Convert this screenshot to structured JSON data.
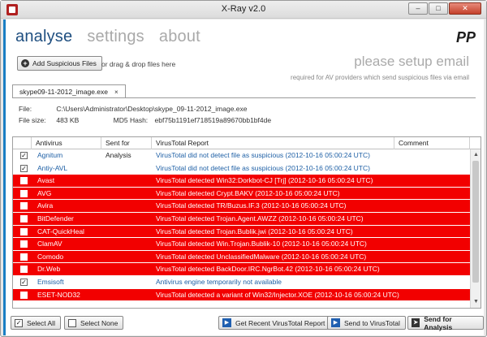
{
  "window": {
    "title": "X-Ray v2.0"
  },
  "nav": {
    "tabs": [
      {
        "label": "analyse"
      },
      {
        "label": "settings"
      },
      {
        "label": "about"
      }
    ]
  },
  "logo_text": "PP",
  "toolbar": {
    "add_label": "Add Suspicious Files",
    "drag_text": "or drag & drop files here"
  },
  "email_notice": {
    "title": "please setup email",
    "subtitle": "required for AV providers which send suspicious files via email"
  },
  "file_tab": {
    "label": "skype09-11-2012_image.exe",
    "close": "×"
  },
  "file_info": {
    "file_label": "File:",
    "file_path": "C:\\Users\\Administrator\\Desktop\\skype_09-11-2012_image.exe",
    "size_label": "File size:",
    "size_value": "483 KB",
    "md5_label": "MD5 Hash:",
    "md5_value": "ebf75b1191ef718519a89670bb1bf4de"
  },
  "grid": {
    "columns": [
      "Antivirus",
      "Sent for Analysis",
      "VirusTotal Report",
      "Comment"
    ],
    "rows": [
      {
        "checked": true,
        "detected": false,
        "antivirus": "Agnitum",
        "report": "VirusTotal did not detect file as suspicious (2012-10-16 05:00:24 UTC)"
      },
      {
        "checked": true,
        "detected": false,
        "antivirus": "Antiy-AVL",
        "report": "VirusTotal did not detect file as suspicious (2012-10-16 05:00:24 UTC)"
      },
      {
        "checked": false,
        "detected": true,
        "antivirus": "Avast",
        "report": "VirusTotal detected Win32:Dorkbot-CJ [Trj] (2012-10-16 05:00:24 UTC)"
      },
      {
        "checked": false,
        "detected": true,
        "antivirus": "AVG",
        "report": "VirusTotal detected Crypt.BAKV (2012-10-16 05:00:24 UTC)"
      },
      {
        "checked": false,
        "detected": true,
        "antivirus": "Avira",
        "report": "VirusTotal detected TR/Buzus.IF.3 (2012-10-16 05:00:24 UTC)"
      },
      {
        "checked": false,
        "detected": true,
        "antivirus": "BitDefender",
        "report": "VirusTotal detected Trojan.Agent.AWZZ (2012-10-16 05:00:24 UTC)"
      },
      {
        "checked": false,
        "detected": true,
        "antivirus": "CAT-QuickHeal",
        "report": "VirusTotal detected Trojan.Bublik.jwi (2012-10-16 05:00:24 UTC)"
      },
      {
        "checked": false,
        "detected": true,
        "antivirus": "ClamAV",
        "report": "VirusTotal detected Win.Trojan.Bublik-10 (2012-10-16 05:00:24 UTC)"
      },
      {
        "checked": false,
        "detected": true,
        "antivirus": "Comodo",
        "report": "VirusTotal detected UnclassifiedMalware (2012-10-16 05:00:24 UTC)"
      },
      {
        "checked": false,
        "detected": true,
        "antivirus": "Dr.Web",
        "report": "VirusTotal detected BackDoor.IRC.NgrBot.42 (2012-10-16 05:00:24 UTC)"
      },
      {
        "checked": true,
        "detected": false,
        "antivirus": "Emsisoft",
        "report": "Antivirus engine temporarily not available"
      },
      {
        "checked": false,
        "detected": true,
        "antivirus": "ESET-NOD32",
        "report": "VirusTotal detected a variant of Win32/Injector.XOE (2012-10-16 05:00:24 UTC)"
      }
    ]
  },
  "actions": {
    "select_all": "Select All",
    "select_none": "Select None",
    "get_report": "Get Recent VirusTotal Report",
    "send_vt": "Send to VirusTotal",
    "send_analysis": "Send for Analysis"
  },
  "colors": {
    "accent": "#1a7fc4",
    "detected_row": "#f20000",
    "nav_active": "#1f4f80"
  },
  "icons": {
    "minimize": "minimize-icon",
    "maximize": "maximize-icon",
    "close": "close-icon",
    "add": "plus-circle-icon",
    "checkbox": "checkbox-icon",
    "report": "virustotal-arrow-icon",
    "send": "send-arrow-icon"
  }
}
